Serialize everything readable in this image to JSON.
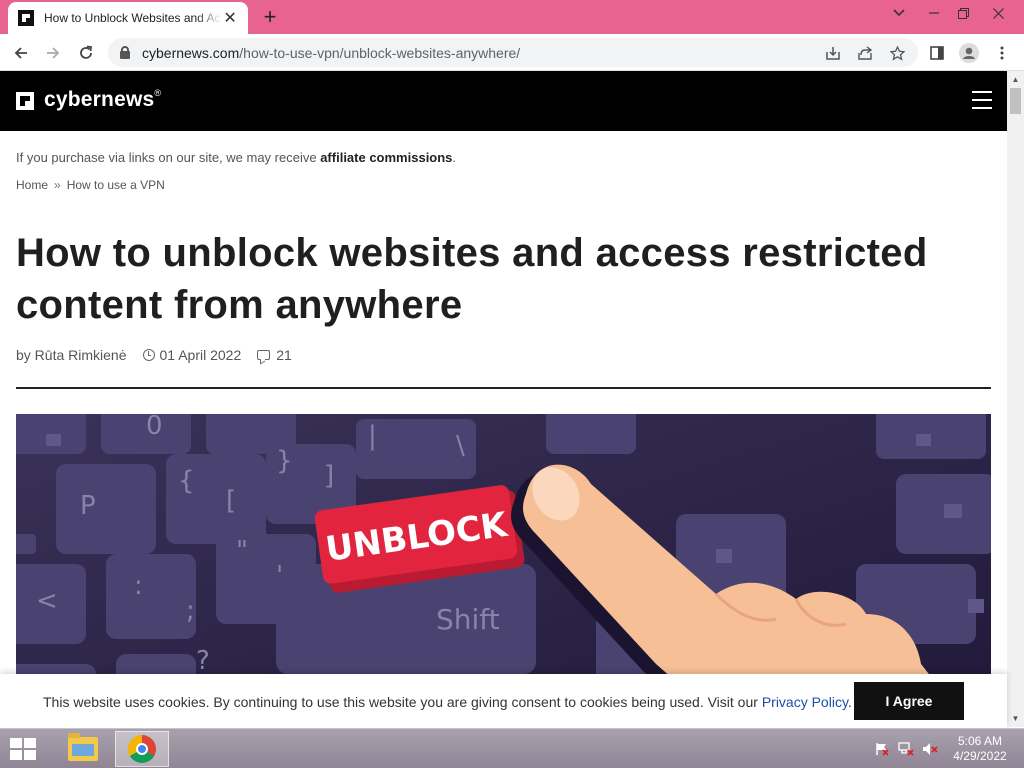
{
  "browser": {
    "tab_title": "How to Unblock Websites and Access Restricted Content from Anywhere",
    "close_glyph": "✕",
    "newtab_glyph": "+",
    "url_domain": "cybernews.com",
    "url_path": "/how-to-use-vpn/unblock-websites-anywhere/"
  },
  "site": {
    "logo": "cybernews",
    "logo_mark": "®",
    "affiliate_prefix": "If you purchase via links on our site, we may receive ",
    "affiliate_bold": "affiliate commissions",
    "affiliate_suffix": ".",
    "breadcrumb": [
      "Home",
      "How to use a VPN"
    ],
    "breadcrumb_sep": "»"
  },
  "article": {
    "title": "How to unblock websites and access restricted content from anywhere",
    "author": "by Rūta Rimkienė",
    "date": "01 April 2022",
    "comments": "21",
    "hero_button_text": "UNBLOCK",
    "hero_keys": [
      "P",
      "{",
      "[",
      "}",
      "]",
      "\\",
      "|",
      "\"",
      "'",
      "<",
      ":",
      ";",
      "?",
      "Shift"
    ]
  },
  "cookie": {
    "text": "This website uses cookies. By continuing to use this website you are giving consent to cookies being used. Visit our ",
    "link": "Privacy Policy",
    "text_end": ".",
    "button": "I Agree"
  },
  "taskbar": {
    "time": "5:06 AM",
    "date": "4/29/2022"
  },
  "colors": {
    "tabbar": "#e8638f",
    "header": "#000000",
    "hero_bg": "#2e2648",
    "unblock_red": "#e3243f"
  }
}
